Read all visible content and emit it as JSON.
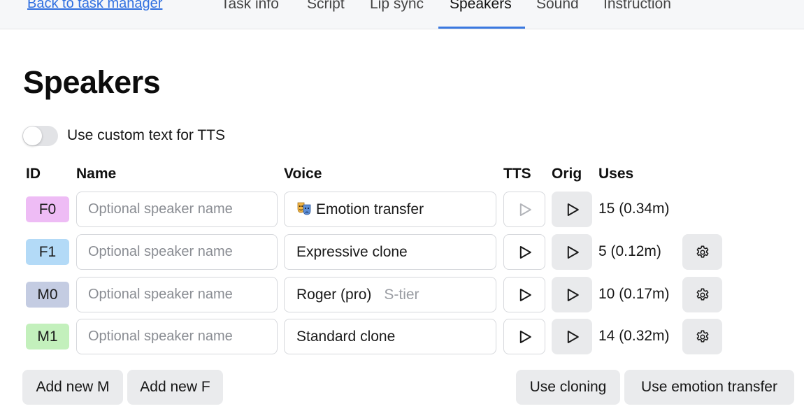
{
  "nav": {
    "back_link": "Back to task manager",
    "tabs": [
      {
        "label": "Task info"
      },
      {
        "label": "Script"
      },
      {
        "label": "Lip sync"
      },
      {
        "label": "Speakers",
        "active": true
      },
      {
        "label": "Sound"
      },
      {
        "label": "Instruction"
      }
    ]
  },
  "page": {
    "title": "Speakers",
    "toggle_label": "Use custom text for TTS",
    "toggle_on": false
  },
  "table": {
    "headers": {
      "id": "ID",
      "name": "Name",
      "voice": "Voice",
      "tts": "TTS",
      "orig": "Orig",
      "uses": "Uses"
    },
    "name_placeholder": "Optional speaker name",
    "rows": [
      {
        "id": "F0",
        "badge_color": "#eebcf5",
        "name": "",
        "voice": "Emotion transfer",
        "voice_icon": "performing-arts-icon",
        "voice_tier": "",
        "uses": "15 (0.34m)",
        "tts_enabled": false,
        "has_settings": false
      },
      {
        "id": "F1",
        "badge_color": "#b3daf7",
        "name": "",
        "voice": "Expressive clone",
        "voice_icon": "",
        "voice_tier": "",
        "uses": "5 (0.12m)",
        "tts_enabled": true,
        "has_settings": true
      },
      {
        "id": "M0",
        "badge_color": "#c4cce2",
        "name": "",
        "voice": "Roger (pro)",
        "voice_icon": "",
        "voice_tier": "S-tier",
        "uses": "10 (0.17m)",
        "tts_enabled": true,
        "has_settings": true
      },
      {
        "id": "M1",
        "badge_color": "#c3f0bc",
        "name": "",
        "voice": "Standard clone",
        "voice_icon": "",
        "voice_tier": "",
        "uses": "14 (0.32m)",
        "tts_enabled": true,
        "has_settings": true
      }
    ]
  },
  "actions": {
    "add_m": "Add new M",
    "add_f": "Add new F",
    "use_cloning": "Use cloning",
    "use_emotion_transfer": "Use emotion transfer"
  },
  "colors": {
    "accent": "#3a78e0",
    "link": "#2f6fe0",
    "button_bg": "#eaebed",
    "border": "#d6d8dc"
  }
}
